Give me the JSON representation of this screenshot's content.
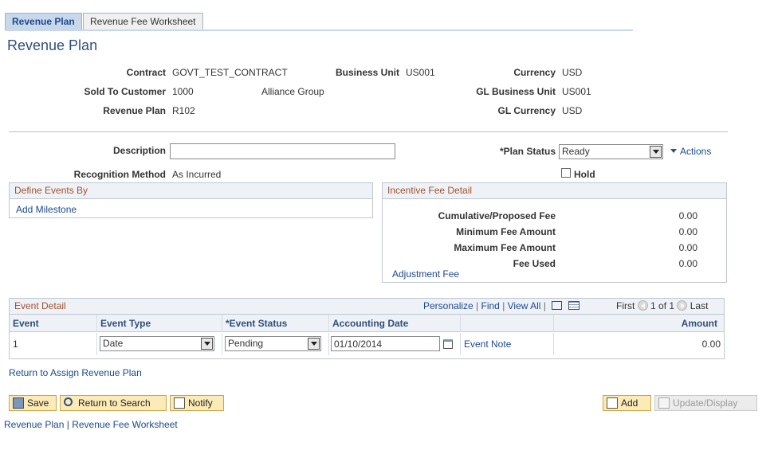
{
  "tabs": [
    {
      "label": "Revenue Plan"
    },
    {
      "label": "Revenue Fee Worksheet"
    }
  ],
  "page_title": "Revenue Plan",
  "header": {
    "contract_label": "Contract",
    "contract_value": "GOVT_TEST_CONTRACT",
    "business_unit_label": "Business Unit",
    "business_unit_value": "US001",
    "currency_label": "Currency",
    "currency_value": "USD",
    "sold_to_label": "Sold To Customer",
    "sold_to_value": "1000",
    "sold_to_name": "Alliance Group",
    "gl_bu_label": "GL Business Unit",
    "gl_bu_value": "US001",
    "revenue_plan_label": "Revenue Plan",
    "revenue_plan_value": "R102",
    "gl_currency_label": "GL Currency",
    "gl_currency_value": "USD"
  },
  "form": {
    "description_label": "Description",
    "description_value": "",
    "plan_status_label": "*Plan Status",
    "plan_status_value": "Ready",
    "actions_label": "Actions",
    "recognition_label": "Recognition Method",
    "recognition_value": "As Incurred",
    "hold_label": "Hold"
  },
  "define_events": {
    "title": "Define Events By",
    "link": "Add Milestone"
  },
  "incentive": {
    "title": "Incentive Fee Detail",
    "rows": [
      {
        "label": "Cumulative/Proposed Fee",
        "value": "0.00"
      },
      {
        "label": "Minimum Fee Amount",
        "value": "0.00"
      },
      {
        "label": "Maximum Fee Amount",
        "value": "0.00"
      },
      {
        "label": "Fee Used",
        "value": "0.00"
      }
    ],
    "link": "Adjustment Fee"
  },
  "event_detail": {
    "title": "Event Detail",
    "personalize": "Personalize",
    "find": "Find",
    "view_all": "View All",
    "first": "First",
    "range": "1 of 1",
    "last": "Last",
    "columns": [
      "Event",
      "Event Type",
      "*Event Status",
      "Accounting Date",
      "Amount"
    ],
    "row": {
      "event": "1",
      "event_type": "Date",
      "event_status": "Pending",
      "accounting_date": "01/10/2014",
      "event_note": "Event Note",
      "amount": "0.00"
    }
  },
  "return_link": "Return to Assign Revenue Plan",
  "buttons": {
    "save": "Save",
    "return_search": "Return to Search",
    "notify": "Notify",
    "add": "Add",
    "update_display": "Update/Display"
  },
  "footer": {
    "link1": "Revenue Plan",
    "separator": "|",
    "link2": "Revenue Fee Worksheet"
  }
}
